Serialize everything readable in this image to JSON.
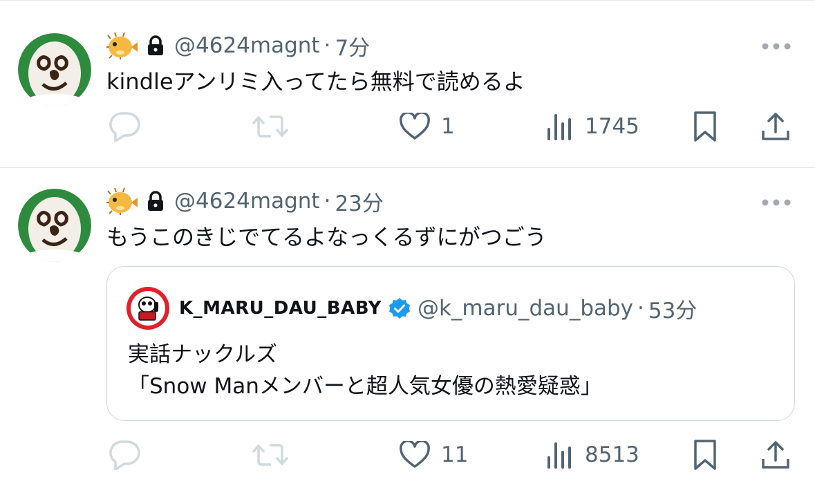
{
  "tweets": [
    {
      "author_emoji": "puffer-fish",
      "handle": "@4624magnt",
      "separator": "·",
      "time": "7分",
      "text": "kindleアンリミ入ってたら無料で読めるよ",
      "replies": "",
      "retweets": "",
      "likes": "1",
      "views": "1745"
    },
    {
      "author_emoji": "puffer-fish",
      "handle": "@4624magnt",
      "separator": "·",
      "time": "23分",
      "text": "もうこのきじでてるよなっくるずにがつごう",
      "quote": {
        "name": "K_MARU_DAU_BABY",
        "handle": "@k_maru_dau_baby",
        "separator": "·",
        "time": "53分",
        "text_line1": "実話ナックルズ",
        "text_line2": "「Snow Manメンバーと超人気女優の熱愛疑惑」"
      },
      "replies": "",
      "retweets": "",
      "likes": "11",
      "views": "8513"
    }
  ],
  "colors": {
    "text": "#0f1419",
    "secondary": "#536471",
    "icon_light": "#cfd9de",
    "border": "#cfd9de",
    "verified": "#1d9bf0"
  },
  "icons": [
    "puffer-fish-emoji",
    "lock-icon",
    "more-icon",
    "reply-icon",
    "retweet-icon",
    "like-icon",
    "views-icon",
    "bookmark-icon",
    "share-icon",
    "verified-icon"
  ]
}
